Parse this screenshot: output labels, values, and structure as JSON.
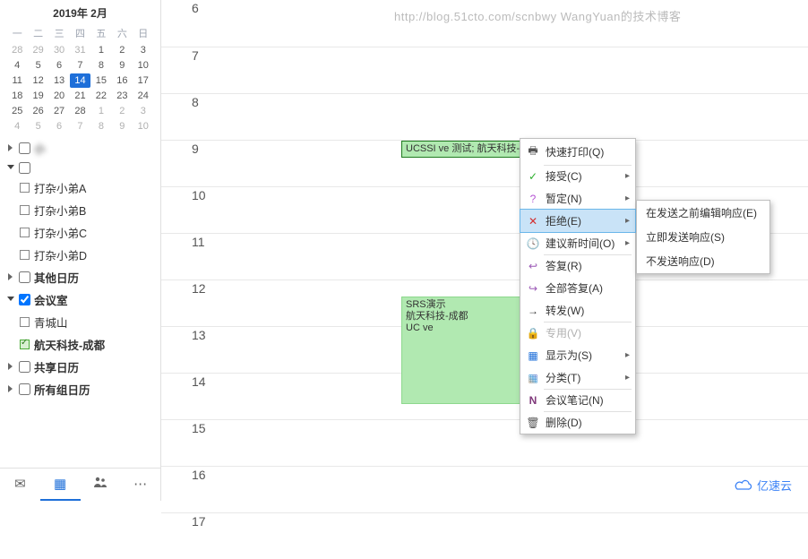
{
  "watermark": "http://blog.51cto.com/scnbwy WangYuan的技术博客",
  "logo": "亿速云",
  "mini_cal": {
    "title": "2019年 2月",
    "dow": [
      "一",
      "二",
      "三",
      "四",
      "五",
      "六",
      "日"
    ],
    "prev_start": 28,
    "days": 28,
    "today": 14
  },
  "groups": [
    {
      "type": "group",
      "arrow": "collapsed",
      "check": false,
      "label": "小",
      "blur": true
    },
    {
      "type": "group",
      "arrow": "expanded",
      "check": false,
      "label": "",
      "blur": true
    },
    {
      "type": "item",
      "checked": false,
      "label": "打杂小弟A"
    },
    {
      "type": "item",
      "checked": false,
      "label": "打杂小弟B"
    },
    {
      "type": "item",
      "checked": false,
      "label": "打杂小弟C"
    },
    {
      "type": "item",
      "checked": false,
      "label": "打杂小弟D"
    },
    {
      "type": "group",
      "arrow": "collapsed",
      "check": false,
      "label": "其他日历",
      "bold": true
    },
    {
      "type": "group",
      "arrow": "expanded",
      "check": true,
      "label": "会议室",
      "bold": true
    },
    {
      "type": "item",
      "checked": false,
      "label": "青城山"
    },
    {
      "type": "item",
      "checked": true,
      "label": "航天科技-成都",
      "bold": true
    },
    {
      "type": "group",
      "arrow": "collapsed",
      "check": false,
      "label": "共享日历",
      "bold": true
    },
    {
      "type": "group",
      "arrow": "collapsed",
      "check": false,
      "label": "所有组日历",
      "bold": true
    }
  ],
  "hours": [
    "6",
    "7",
    "8",
    "9",
    "10",
    "11",
    "12",
    "13",
    "14",
    "15",
    "16",
    "17"
  ],
  "events": {
    "ev1": "UCSSI          ve 测试; 航天科技-成都; L",
    "ev2_l1": "SRS演示",
    "ev2_l2": "航天科技-成都",
    "ev2_l3": "UC          ve"
  },
  "context_menu": [
    {
      "icon": "🖶",
      "cls": "ic-print",
      "label": "快速打印(Q)",
      "sep": true
    },
    {
      "icon": "✓",
      "cls": "ic-check",
      "label": "接受(C)",
      "sub": true
    },
    {
      "icon": "?",
      "cls": "ic-q",
      "label": "暂定(N)",
      "sub": true
    },
    {
      "icon": "✕",
      "cls": "ic-x",
      "label": "拒绝(E)",
      "sub": true,
      "highlight": true
    },
    {
      "icon": "🕓",
      "cls": "ic-clock",
      "label": "建议新时间(O)",
      "sub": true,
      "sep": true
    },
    {
      "icon": "↩",
      "cls": "ic-arrow",
      "label": "答复(R)"
    },
    {
      "icon": "↪",
      "cls": "ic-arrow",
      "label": "全部答复(A)"
    },
    {
      "icon": "→",
      "cls": "",
      "label": "转发(W)",
      "sep": true
    },
    {
      "icon": "🔒",
      "cls": "ic-lock",
      "label": "专用(V)",
      "disabled": true
    },
    {
      "icon": "▦",
      "cls": "ic-square",
      "label": "显示为(S)",
      "sub": true
    },
    {
      "icon": "▦",
      "cls": "ic-cat",
      "label": "分类(T)",
      "sub": true,
      "sep": true
    },
    {
      "icon": "N",
      "cls": "ic-note",
      "label": "会议笔记(N)",
      "sep": true
    },
    {
      "icon": "🗑",
      "cls": "ic-del",
      "label": "删除(D)"
    }
  ],
  "submenu": [
    "在发送之前编辑响应(E)",
    "立即发送响应(S)",
    "不发送响应(D)"
  ]
}
